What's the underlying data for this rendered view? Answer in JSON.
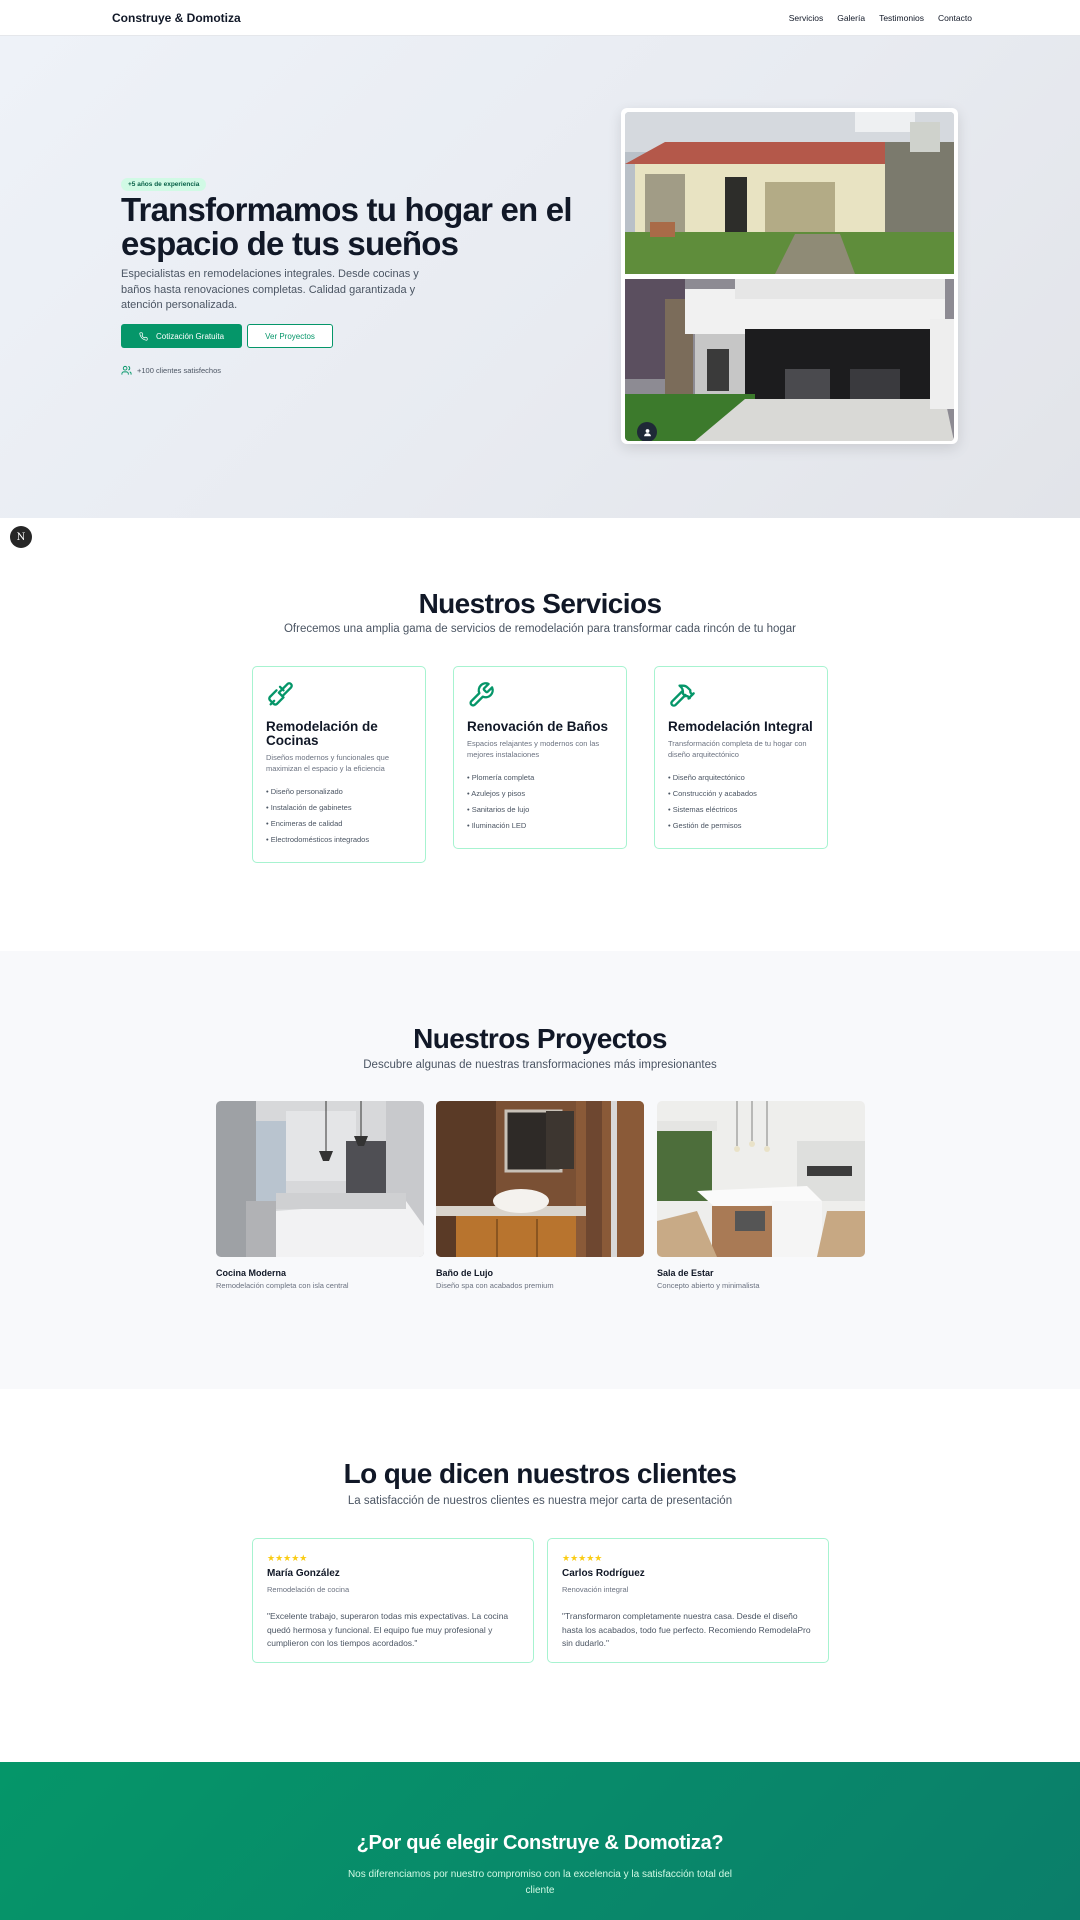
{
  "nav": {
    "brand": "Construye & Domotiza",
    "links": [
      "Servicios",
      "Galería",
      "Testimonios",
      "Contacto"
    ]
  },
  "hero": {
    "badge": "+5 años de experiencia",
    "title": "Transformamos tu hogar en el espacio de tus sueños",
    "description": "Especialistas en remodelaciones integrales. Desde cocinas y baños hasta renovaciones completas. Calidad garantizada y atención personalizada.",
    "primary_button": "Cotización Gratuita",
    "secondary_button": "Ver Proyectos",
    "clients": "+100 clientes satisfechos",
    "floating_badge": "N"
  },
  "services": {
    "title": "Nuestros Servicios",
    "subtitle": "Ofrecemos una amplia gama de servicios de remodelación para transformar cada rincón de tu hogar",
    "items": [
      {
        "icon": "paintbrush-icon",
        "title": "Remodelación de Cocinas",
        "description": "Diseños modernos y funcionales que maximizan el espacio y la eficiencia",
        "features": [
          "• Diseño personalizado",
          "• Instalación de gabinetes",
          "• Encimeras de calidad",
          "• Electrodomésticos integrados"
        ]
      },
      {
        "icon": "wrench-icon",
        "title": "Renovación de Baños",
        "description": "Espacios relajantes y modernos con las mejores instalaciones",
        "features": [
          "• Plomería completa",
          "• Azulejos y pisos",
          "• Sanitarios de lujo",
          "• Iluminación LED"
        ]
      },
      {
        "icon": "hammer-icon",
        "title": "Remodelación Integral",
        "description": "Transformación completa de tu hogar con diseño arquitectónico",
        "features": [
          "• Diseño arquitectónico",
          "• Construcción y acabados",
          "• Sistemas eléctricos",
          "• Gestión de permisos"
        ]
      }
    ]
  },
  "projects": {
    "title": "Nuestros Proyectos",
    "subtitle": "Descubre algunas de nuestras transformaciones más impresionantes",
    "items": [
      {
        "title": "Cocina Moderna",
        "description": "Remodelación completa con isla central"
      },
      {
        "title": "Baño de Lujo",
        "description": "Diseño spa con acabados premium"
      },
      {
        "title": "Sala de Estar",
        "description": "Concepto abierto y minimalista"
      }
    ]
  },
  "testimonials": {
    "title": "Lo que dicen nuestros clientes",
    "subtitle": "La satisfacción de nuestros clientes es nuestra mejor carta de presentación",
    "items": [
      {
        "stars": "★★★★★",
        "rating": 5,
        "name": "María González",
        "role": "Remodelación de cocina",
        "quote": "\"Excelente trabajo, superaron todas mis expectativas. La cocina quedó hermosa y funcional. El equipo fue muy profesional y cumplieron con los tiempos acordados.\""
      },
      {
        "stars": "★★★★★",
        "rating": 5,
        "name": "Carlos Rodríguez",
        "role": "Renovación integral",
        "quote": "\"Transformaron completamente nuestra casa. Desde el diseño hasta los acabados, todo fue perfecto. Recomiendo RemodelaPro sin dudarlo.\""
      }
    ]
  },
  "why": {
    "title": "¿Por qué elegir Construye & Domotiza?",
    "subtitle": "Nos diferenciamos por nuestro compromiso con la excelencia y la satisfacción total del cliente"
  },
  "colors": {
    "accent": "#059669",
    "accent_light": "#d1fae5",
    "border": "#a7f3d0",
    "star": "#facc15"
  }
}
